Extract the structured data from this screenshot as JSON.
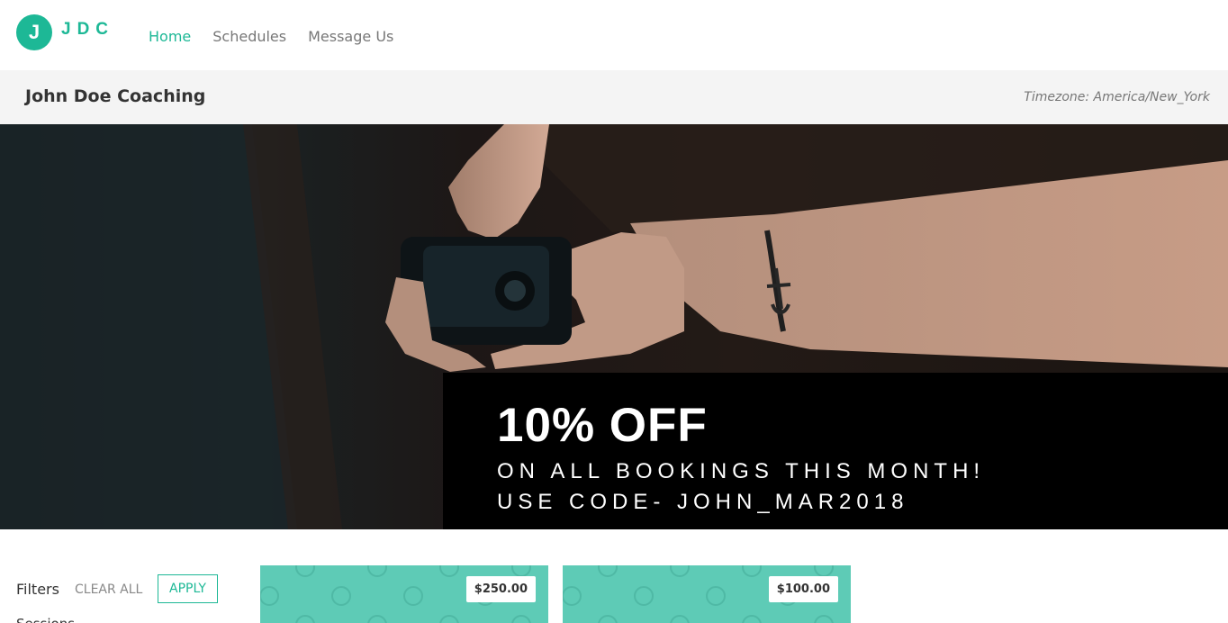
{
  "header": {
    "logo_letter": "J",
    "logo_text": "JDC",
    "nav": [
      {
        "label": "Home",
        "active": true
      },
      {
        "label": "Schedules",
        "active": false
      },
      {
        "label": "Message Us",
        "active": false
      }
    ]
  },
  "subheader": {
    "title": "John Doe Coaching",
    "timezone": "Timezone: America/New_York"
  },
  "hero": {
    "headline": "10% OFF",
    "line1": "ON ALL BOOKINGS THIS MONTH!",
    "line2": "USE CODE- JOHN_MAR2018"
  },
  "filters": {
    "label": "Filters",
    "clear_all": "CLEAR ALL",
    "apply": "APPLY",
    "next_section": "Sessions"
  },
  "cards": [
    {
      "price": "$250.00"
    },
    {
      "price": "$100.00"
    }
  ],
  "colors": {
    "accent": "#1db896",
    "card_bg": "#5ecbb6",
    "subheader_bg": "#f4f4f4"
  }
}
